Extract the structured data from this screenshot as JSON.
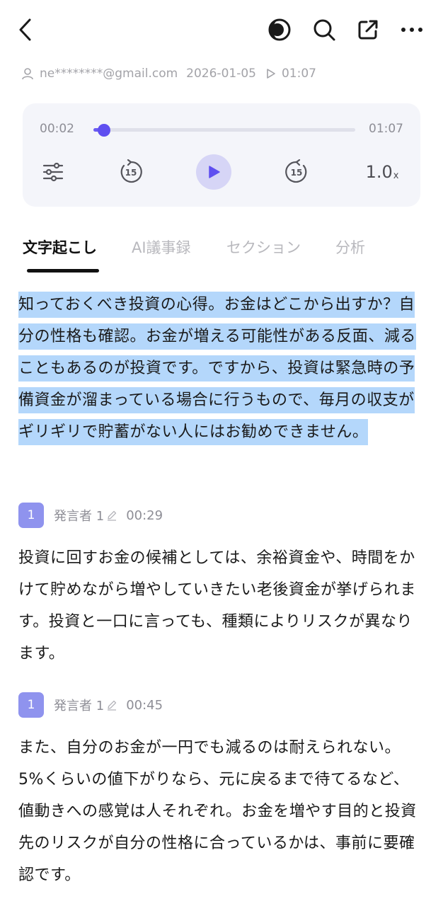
{
  "header": {
    "back_icon": "chevron-left-icon",
    "theme_icon": "half-moon-icon",
    "search_icon": "search-icon",
    "share_icon": "external-link-icon",
    "more_icon": "more-horizontal-icon"
  },
  "meta": {
    "user": "ne********@gmail.com",
    "date": "2026-01-05",
    "duration": "01:07"
  },
  "player": {
    "current_time": "00:02",
    "total_time": "01:07",
    "progress": 0.04,
    "rewind_seconds": "15",
    "forward_seconds": "15",
    "speed": "1.0",
    "speed_suffix": "x",
    "accent_color": "#5f4ff0"
  },
  "tabs": [
    {
      "label": "文字起こし",
      "active": true
    },
    {
      "label": "AI議事録",
      "active": false
    },
    {
      "label": "セクション",
      "active": false
    },
    {
      "label": "分析",
      "active": false
    }
  ],
  "transcript": {
    "intro": "知っておくべき投資の心得。お金はどこから出すか？自分の性格も確認。お金が増える可能性がある反面、減ることもあるのが投資です。ですから、投資は緊急時の予備資金が溜まっている場合に行うもので、毎月の収支がギリギリで貯蓄がない人にはお勧めできません。",
    "segments": [
      {
        "avatar": "1",
        "speaker": "発言者 1",
        "time": "00:29",
        "text": "投資に回すお金の候補としては、余裕資金や、時間をかけて貯めながら増やしていきたい老後資金が挙げられます。投資と一口に言っても、種類によりリスクが異なります。"
      },
      {
        "avatar": "1",
        "speaker": "発言者 1",
        "time": "00:45",
        "text": "また、自分のお金が一円でも減るのは耐えられない。5%くらいの値下がりなら、元に戻るまで待てるなど、値動きへの感覚は人それぞれ。お金を増やす目的と投資先のリスクが自分の性格に合っているかは、事前に要確認です。"
      }
    ]
  }
}
